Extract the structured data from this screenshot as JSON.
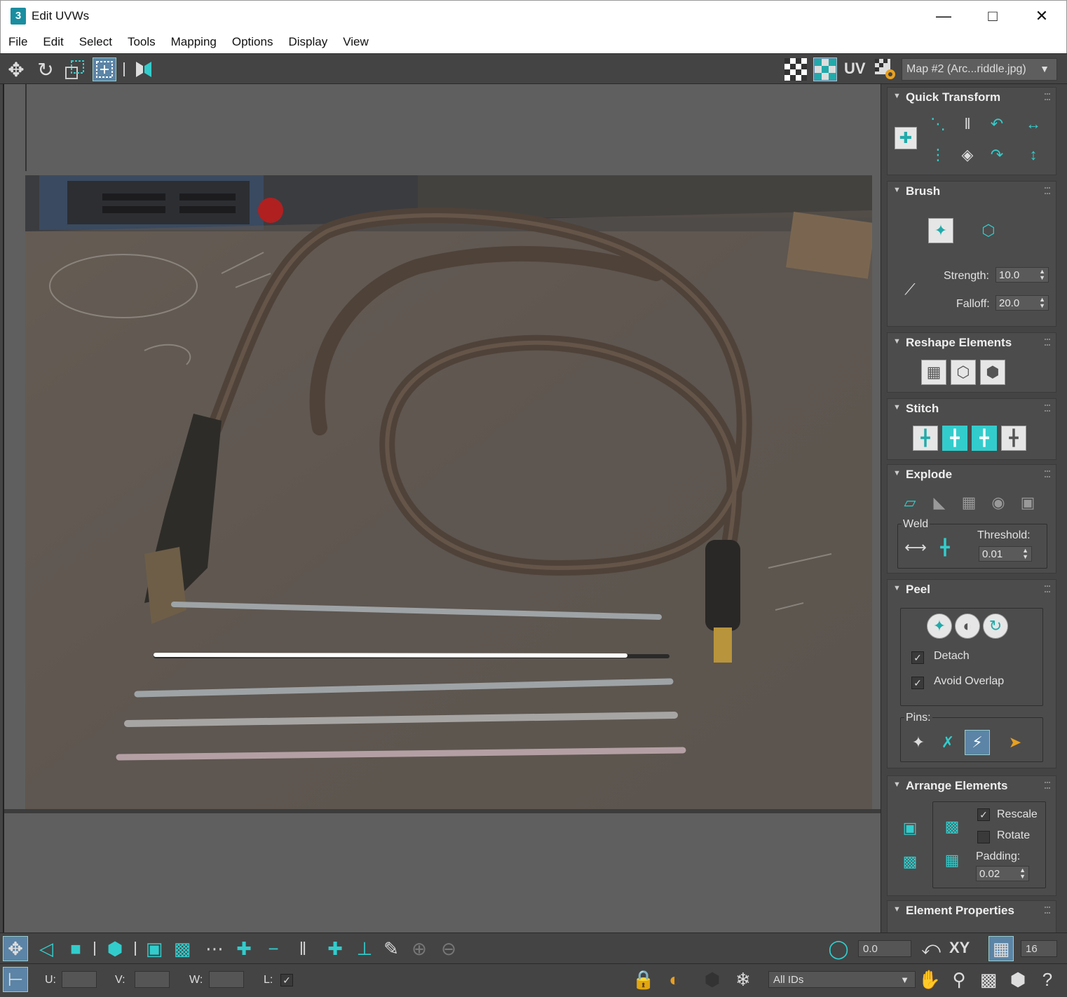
{
  "window": {
    "title": "Edit UVWs",
    "app_icon_text": "3"
  },
  "menu": [
    "File",
    "Edit",
    "Select",
    "Tools",
    "Mapping",
    "Options",
    "Display",
    "View"
  ],
  "toolbar": {
    "uv_label": "UV",
    "map_select": "Map #2 (Arc...riddle.jpg)"
  },
  "panel": {
    "quick_transform": {
      "title": "Quick Transform"
    },
    "brush": {
      "title": "Brush",
      "strength_label": "Strength:",
      "strength_value": "10.0",
      "falloff_label": "Falloff:",
      "falloff_value": "20.0"
    },
    "reshape": {
      "title": "Reshape Elements"
    },
    "stitch": {
      "title": "Stitch"
    },
    "explode": {
      "title": "Explode",
      "weld_label": "Weld",
      "threshold_label": "Threshold:",
      "threshold_value": "0.01"
    },
    "peel": {
      "title": "Peel",
      "detach_label": "Detach",
      "detach_checked": true,
      "avoid_overlap_label": "Avoid Overlap",
      "avoid_overlap_checked": true,
      "pins_label": "Pins:"
    },
    "arrange": {
      "title": "Arrange Elements",
      "rescale_label": "Rescale",
      "rescale_checked": true,
      "rotate_label": "Rotate",
      "rotate_checked": false,
      "padding_label": "Padding:",
      "padding_value": "0.02"
    },
    "element_props": {
      "title": "Element Properties"
    }
  },
  "bottom": {
    "angle_value": "0.0",
    "xy_label": "XY",
    "grid_value": "16",
    "u_label": "U:",
    "v_label": "V:",
    "w_label": "W:",
    "l_label": "L:",
    "ids_select": "All IDs"
  },
  "colors": {
    "accent": "#33cccc",
    "panel_bg": "#444444",
    "title_bg": "#ffffff"
  }
}
